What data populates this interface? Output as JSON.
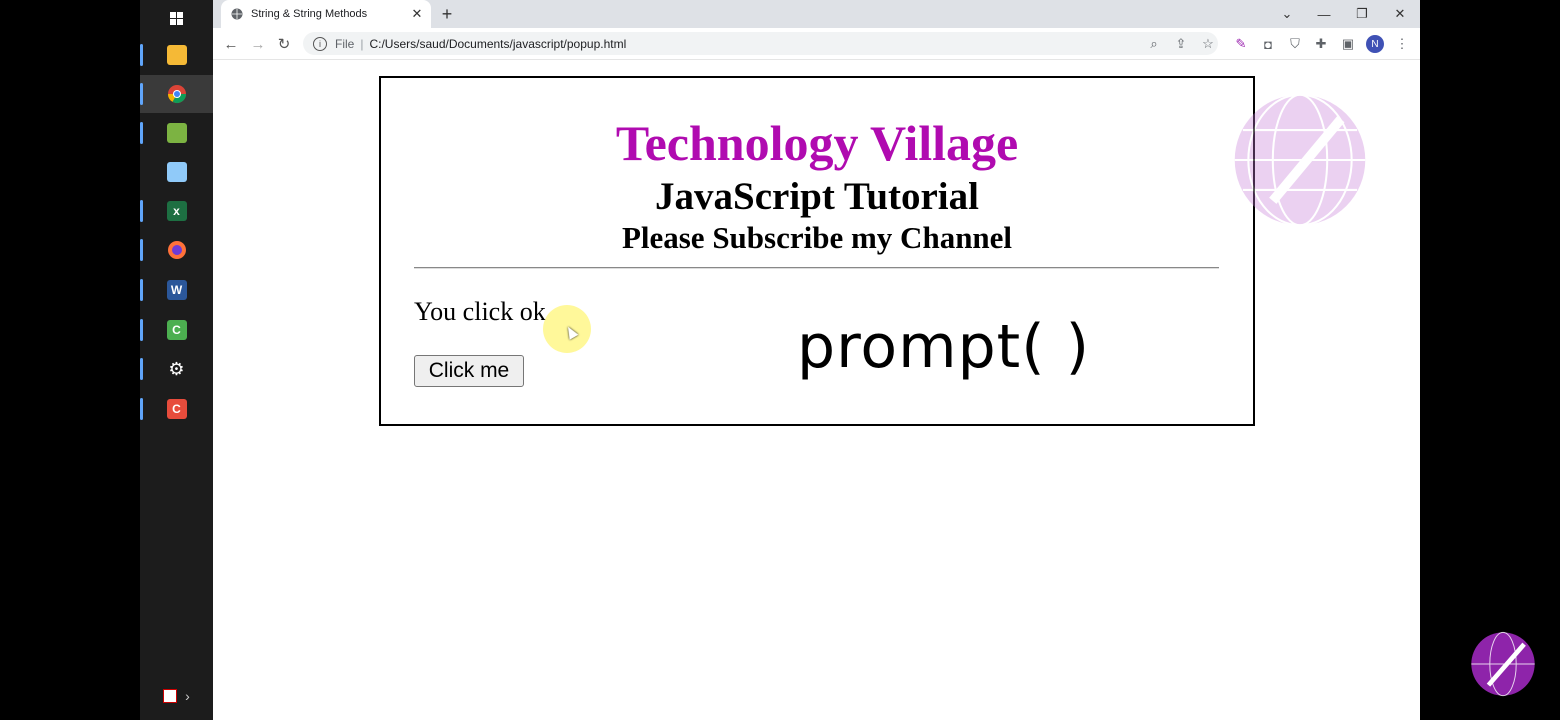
{
  "taskbar": {
    "items": [
      {
        "name": "windows-start",
        "icon": "windows-icon"
      },
      {
        "name": "file-explorer",
        "icon": "folder-icon"
      },
      {
        "name": "chrome",
        "icon": "chrome-icon"
      },
      {
        "name": "photos",
        "icon": "image-icon"
      },
      {
        "name": "notes",
        "icon": "notepad-icon"
      },
      {
        "name": "excel",
        "icon": "excel-icon",
        "letter": "x"
      },
      {
        "name": "firefox",
        "icon": "firefox-icon"
      },
      {
        "name": "word",
        "icon": "word-icon",
        "letter": "W"
      },
      {
        "name": "camtasia",
        "icon": "camtasia-icon",
        "letter": "C"
      },
      {
        "name": "settings",
        "icon": "gear-icon"
      },
      {
        "name": "recorder",
        "icon": "recorder-icon",
        "letter": "C"
      }
    ]
  },
  "browser": {
    "tab_title": "String & String Methods",
    "scheme_label": "File",
    "url": "C:/Users/saud/Documents/javascript/popup.html",
    "avatar_letter": "N"
  },
  "page": {
    "title": "Technology Village",
    "subtitle": "JavaScript Tutorial",
    "tagline": "Please Subscribe my Channel",
    "message": "You click ok",
    "button_label": "Click me",
    "overlay_text": "prompt( )"
  },
  "colors": {
    "title": "#b00bb0",
    "accent": "#60a5fa"
  }
}
